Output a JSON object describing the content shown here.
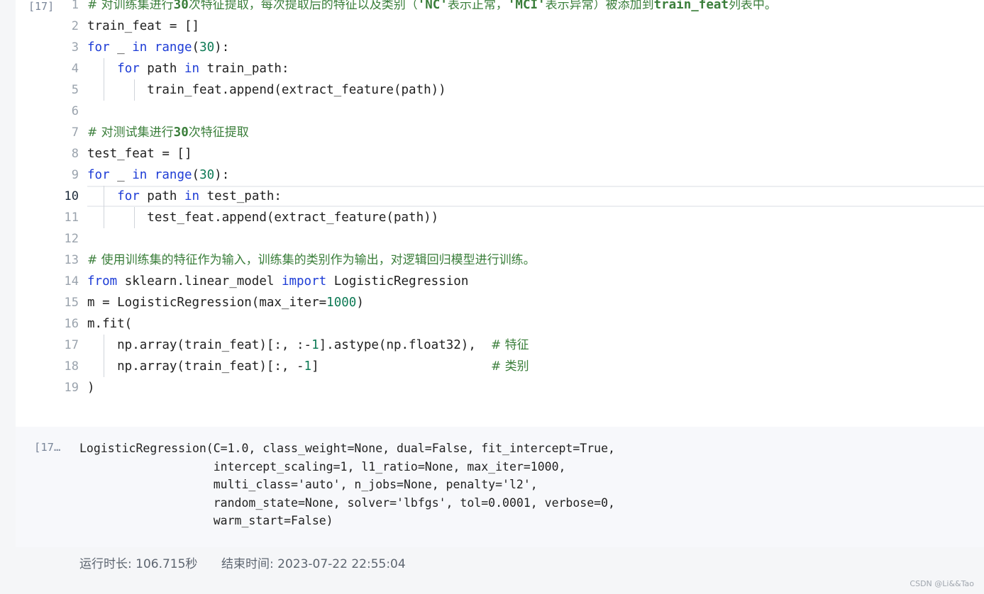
{
  "cell": {
    "prompt": "[17]",
    "lines": [
      {
        "n": "1",
        "html": "<span class=\"cm\"># 对训练集进行</span><span class=\"cmb\">30</span><span class=\"cm\">次特征提取，每次提取后的特征以及类别（</span><span class=\"cmb\">'NC'</span><span class=\"cm\">表示正常，</span><span class=\"cmb\">'MCI'</span><span class=\"cm\">表示异常）被添加到</span><span class=\"cmb\">train_feat</span><span class=\"cm\">列表中。</span>"
      },
      {
        "n": "2",
        "html": "train_feat = []"
      },
      {
        "n": "3",
        "html": "<span class=\"kw\">for</span> _ <span class=\"kw\">in</span> <span class=\"kw\">range</span>(<span class=\"num\">30</span>):"
      },
      {
        "n": "4",
        "html": "    <span class=\"kw\">for</span> path <span class=\"kw\">in</span> train_path:"
      },
      {
        "n": "5",
        "html": "        train_feat.append(extract_feature(path))"
      },
      {
        "n": "6",
        "html": ""
      },
      {
        "n": "7",
        "html": "<span class=\"cm\"># 对测试集进行</span><span class=\"cmb\">30</span><span class=\"cm\">次特征提取</span>"
      },
      {
        "n": "8",
        "html": "test_feat = []"
      },
      {
        "n": "9",
        "html": "<span class=\"kw\">for</span> _ <span class=\"kw\">in</span> <span class=\"kw\">range</span>(<span class=\"num\">30</span>):"
      },
      {
        "n": "10",
        "html": "    <span class=\"kw\">for</span> path <span class=\"kw\">in</span> test_path:",
        "active": true
      },
      {
        "n": "11",
        "html": "        test_feat.append(extract_feature(path))"
      },
      {
        "n": "12",
        "html": ""
      },
      {
        "n": "13",
        "html": "<span class=\"cm\"># 使用训练集的特征作为输入，训练集的类别作为输出，对逻辑回归模型进行训练。</span>"
      },
      {
        "n": "14",
        "html": "<span class=\"kw\">from</span> sklearn.linear_model <span class=\"kw\">import</span> LogisticRegression"
      },
      {
        "n": "15",
        "html": "m = LogisticRegression(max_iter=<span class=\"num\">1000</span>)"
      },
      {
        "n": "16",
        "html": "m.fit("
      },
      {
        "n": "17",
        "html": "    np.array(train_feat)[:, :-<span class=\"num\">1</span>].astype(np.float32),  <span class=\"cm\"># 特征</span>"
      },
      {
        "n": "18",
        "html": "    np.array(train_feat)[:, -<span class=\"num\">1</span>]                       <span class=\"cm\"># 类别</span>"
      },
      {
        "n": "19",
        "html": ")"
      }
    ]
  },
  "output": {
    "prompt": "[17…",
    "text": "LogisticRegression(C=1.0, class_weight=None, dual=False, fit_intercept=True,\n                   intercept_scaling=1, l1_ratio=None, max_iter=1000,\n                   multi_class='auto', n_jobs=None, penalty='l2',\n                   random_state=None, solver='lbfgs', tol=0.0001, verbose=0,\n                   warm_start=False)"
  },
  "status": {
    "runtime": "运行时长:  106.715秒",
    "endtime": "结束时间:  2023-07-22 22:55:04"
  },
  "watermark": "CSDN @Li&&Tao"
}
